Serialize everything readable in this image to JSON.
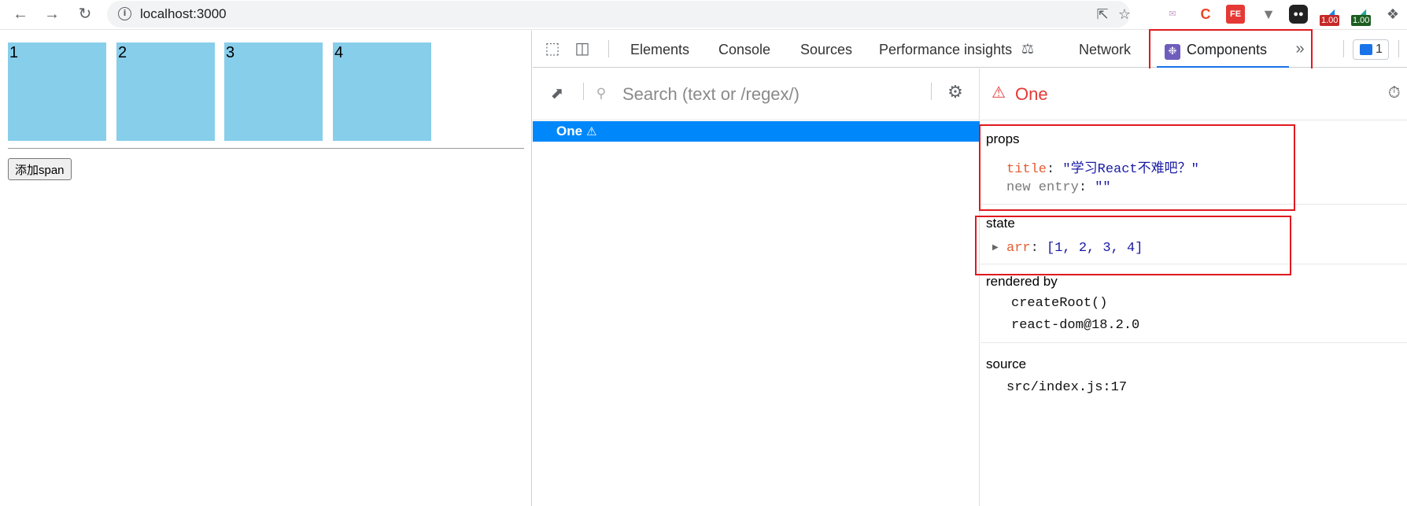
{
  "browser": {
    "url": "localhost:3000",
    "badges": [
      "1.00",
      "1.00"
    ]
  },
  "page": {
    "boxes": [
      "1",
      "2",
      "3",
      "4"
    ],
    "add_button": "添加span",
    "box_color": "#87ceeb"
  },
  "devtools": {
    "tabs": [
      "Elements",
      "Console",
      "Sources",
      "Performance insights",
      "Network",
      "Components"
    ],
    "active_tab": "Components",
    "issues_count": "1",
    "search_placeholder": "Search (text or /regex/)",
    "tree": [
      {
        "label": "One"
      }
    ],
    "selected": {
      "title": "One",
      "props_label": "props",
      "props": [
        {
          "key": "title",
          "value": "\"学习React不难吧？\""
        },
        {
          "key": "new entry",
          "value": "\"\""
        }
      ],
      "state_label": "state",
      "state": [
        {
          "key": "arr",
          "value": "[1, 2, 3, 4]"
        }
      ],
      "rendered_by_label": "rendered by",
      "rendered_by": [
        "createRoot()",
        "react-dom@18.2.0"
      ],
      "source_label": "source",
      "source": "src/index.js:17"
    },
    "accent_color": "#0088fa",
    "warning_color": "#e53935"
  }
}
